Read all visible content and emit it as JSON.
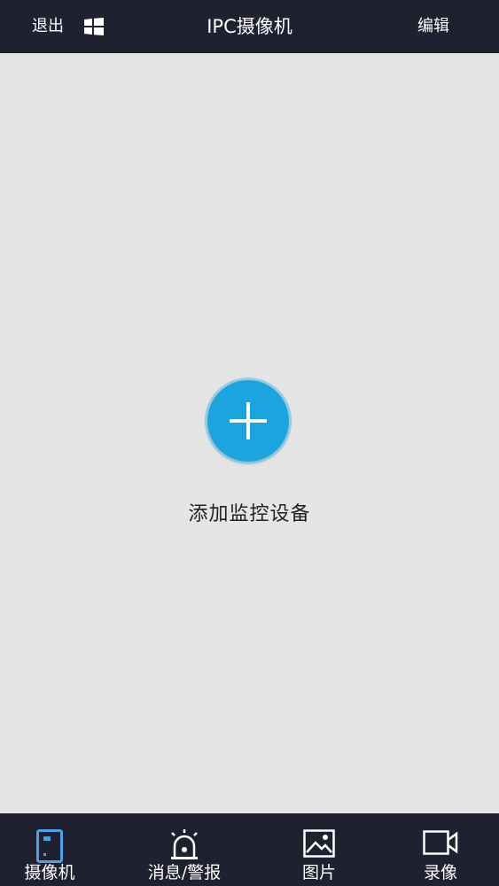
{
  "header": {
    "exit_label": "退出",
    "title": "IPC摄像机",
    "edit_label": "编辑"
  },
  "main": {
    "add_device_label": "添加监控设备"
  },
  "tabs": [
    {
      "label": "摄像机",
      "icon": "camera-device-icon",
      "active": true
    },
    {
      "label": "消息/警报",
      "icon": "alarm-icon",
      "active": false
    },
    {
      "label": "图片",
      "icon": "picture-icon",
      "active": false
    },
    {
      "label": "录像",
      "icon": "video-icon",
      "active": false
    }
  ],
  "colors": {
    "bar_background": "#1f2130",
    "content_background": "#e5e5e6",
    "accent": "#1ba5df",
    "active_tab_icon": "#4aa3e8"
  }
}
